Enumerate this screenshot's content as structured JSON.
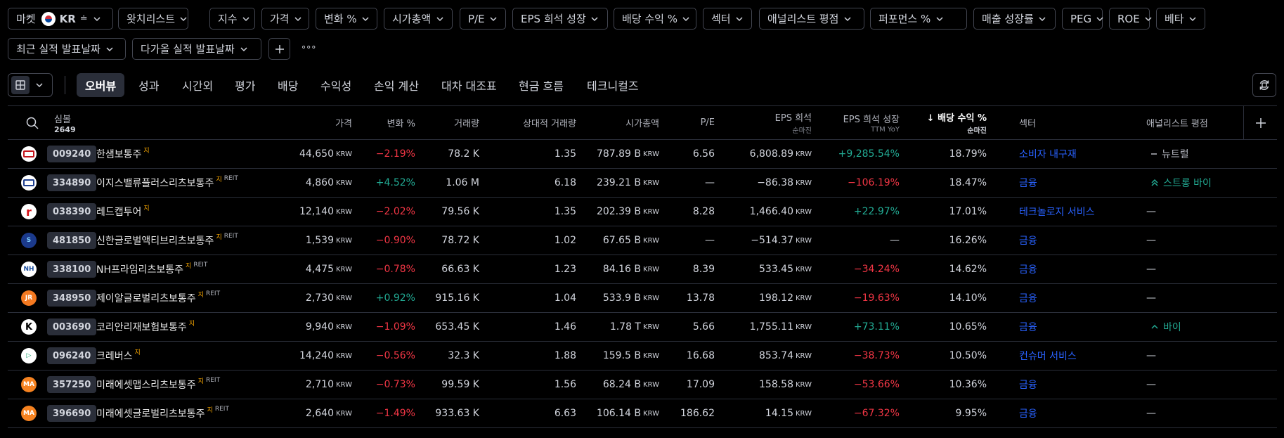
{
  "filters_row1": [
    {
      "label": "마켓",
      "region": "KR",
      "extra": "≐"
    },
    {
      "label": "왓치리스트"
    },
    {
      "label": "지수"
    },
    {
      "label": "가격"
    },
    {
      "label": "변화 %"
    },
    {
      "label": "시가총액"
    },
    {
      "label": "P/E"
    },
    {
      "label": "EPS 희석 성장"
    },
    {
      "label": "배당 수익 %"
    },
    {
      "label": "섹터"
    },
    {
      "label": "애널리스트 평점"
    },
    {
      "label": "퍼포먼스 %"
    },
    {
      "label": "매출 성장률"
    },
    {
      "label": "PEG"
    },
    {
      "label": "ROE"
    },
    {
      "label": "베타"
    }
  ],
  "filters_row2": [
    {
      "label": "최근 실적 발표날짜"
    },
    {
      "label": "다가올 실적 발표날짜"
    }
  ],
  "more_label": "∘∘∘",
  "tabs": [
    "오버뷰",
    "성과",
    "시간외",
    "평가",
    "배당",
    "수익성",
    "손익 계산",
    "대차 대조표",
    "현금 흐름",
    "테크니컬즈"
  ],
  "columns": {
    "symbol": "심볼",
    "count": "2649",
    "price": "가격",
    "change": "변화 %",
    "volume": "거래량",
    "relvol": "상대적 거래량",
    "mcap": "시가총액",
    "pe": "P/E",
    "eps": "EPS 희석",
    "eps_sub": "순마진",
    "epsg": "EPS 희석 성장",
    "epsg_sub": "TTM YoY",
    "div": "↓ 배당 수익 %",
    "div_sub": "순마진",
    "sector": "섹터",
    "analyst": "애널리스트 평점"
  },
  "unit_krw": "KRW",
  "rows": [
    {
      "code": "009240",
      "name": "한샘보통주",
      "di": "지",
      "reit": "",
      "logo_text": "HANSSEM",
      "logo_bg": "#ffffff",
      "logo_fg": "#c4161c",
      "price": "44,650",
      "change": "−2.19%",
      "change_dir": "neg",
      "volume": "78.2 K",
      "relvol": "1.35",
      "mcap": "787.89 B",
      "pe": "6.56",
      "eps": "6,808.89",
      "epsg": "+9,285.54%",
      "epsg_dir": "pos",
      "div": "18.79%",
      "sector": "소비자 내구재",
      "analyst": "뉴트럴",
      "analyst_kind": "neutral"
    },
    {
      "code": "334890",
      "name": "이지스밸류플러스리츠보통주",
      "di": "지",
      "reit": "REIT",
      "logo_text": "IGIS",
      "logo_bg": "#ffffff",
      "logo_fg": "#1f3f8f",
      "price": "4,860",
      "change": "+4.52%",
      "change_dir": "pos",
      "volume": "1.06 M",
      "relvol": "6.18",
      "mcap": "239.21 B",
      "pe": "—",
      "eps": "−86.38",
      "epsg": "−106.19%",
      "epsg_dir": "neg",
      "div": "18.47%",
      "sector": "금융",
      "analyst": "스트롱 바이",
      "analyst_kind": "strongbuy"
    },
    {
      "code": "038390",
      "name": "레드캡투어",
      "di": "지",
      "reit": "",
      "logo_text": "r",
      "logo_bg": "#ffffff",
      "logo_fg": "#d7141a",
      "price": "12,140",
      "change": "−2.02%",
      "change_dir": "neg",
      "volume": "79.56 K",
      "relvol": "1.35",
      "mcap": "202.39 B",
      "pe": "8.28",
      "eps": "1,466.40",
      "epsg": "+22.97%",
      "epsg_dir": "pos",
      "div": "17.01%",
      "sector": "테크놀로지 서비스",
      "analyst": "—",
      "analyst_kind": "none"
    },
    {
      "code": "481850",
      "name": "신한글로벌액티브리츠보통주",
      "di": "지",
      "reit": "REIT",
      "logo_text": "S",
      "logo_bg": "#1b3a8c",
      "logo_fg": "#7fd1ff",
      "price": "1,539",
      "change": "−0.90%",
      "change_dir": "neg",
      "volume": "78.72 K",
      "relvol": "1.02",
      "mcap": "67.65 B",
      "pe": "—",
      "eps": "−514.37",
      "epsg": "—",
      "epsg_dir": "none",
      "div": "16.26%",
      "sector": "금융",
      "analyst": "—",
      "analyst_kind": "none"
    },
    {
      "code": "338100",
      "name": "NH프라임리츠보통주",
      "di": "지",
      "reit": "REIT",
      "logo_text": "NH",
      "logo_bg": "#ffffff",
      "logo_fg": "#1c4fa0",
      "price": "4,475",
      "change": "−0.78%",
      "change_dir": "neg",
      "volume": "66.63 K",
      "relvol": "1.23",
      "mcap": "84.16 B",
      "pe": "8.39",
      "eps": "533.45",
      "epsg": "−34.24%",
      "epsg_dir": "neg",
      "div": "14.62%",
      "sector": "금융",
      "analyst": "—",
      "analyst_kind": "none"
    },
    {
      "code": "348950",
      "name": "제이알글로벌리츠보통주",
      "di": "지",
      "reit": "REIT",
      "logo_text": "JR",
      "logo_bg": "#f47920",
      "logo_fg": "#ffffff",
      "price": "2,730",
      "change": "+0.92%",
      "change_dir": "pos",
      "volume": "915.16 K",
      "relvol": "1.04",
      "mcap": "533.9 B",
      "pe": "13.78",
      "eps": "198.12",
      "epsg": "−19.63%",
      "epsg_dir": "neg",
      "div": "14.10%",
      "sector": "금융",
      "analyst": "—",
      "analyst_kind": "none"
    },
    {
      "code": "003690",
      "name": "코리안리재보험보통주",
      "di": "지",
      "reit": "",
      "logo_text": "K",
      "logo_bg": "#ffffff",
      "logo_fg": "#000000",
      "price": "9,940",
      "change": "−1.09%",
      "change_dir": "neg",
      "volume": "653.45 K",
      "relvol": "1.46",
      "mcap": "1.78 T",
      "pe": "5.66",
      "eps": "1,755.11",
      "epsg": "+73.11%",
      "epsg_dir": "pos",
      "div": "10.65%",
      "sector": "금융",
      "analyst": "바이",
      "analyst_kind": "buy"
    },
    {
      "code": "096240",
      "name": "크레버스",
      "di": "지",
      "reit": "",
      "logo_text": "▷",
      "logo_bg": "#ffffff",
      "logo_fg": "#1aa36b",
      "price": "14,240",
      "change": "−0.56%",
      "change_dir": "neg",
      "volume": "32.3 K",
      "relvol": "1.88",
      "mcap": "159.5 B",
      "pe": "16.68",
      "eps": "853.74",
      "epsg": "−38.73%",
      "epsg_dir": "neg",
      "div": "10.50%",
      "sector": "컨슈머 서비스",
      "analyst": "—",
      "analyst_kind": "none"
    },
    {
      "code": "357250",
      "name": "미래에셋맵스리츠보통주",
      "di": "지",
      "reit": "REIT",
      "logo_text": "MA",
      "logo_bg": "#f58220",
      "logo_fg": "#ffffff",
      "price": "2,710",
      "change": "−0.73%",
      "change_dir": "neg",
      "volume": "99.59 K",
      "relvol": "1.56",
      "mcap": "68.24 B",
      "pe": "17.09",
      "eps": "158.58",
      "epsg": "−53.66%",
      "epsg_dir": "neg",
      "div": "10.36%",
      "sector": "금융",
      "analyst": "—",
      "analyst_kind": "none"
    },
    {
      "code": "396690",
      "name": "미래에셋글로벌리츠보통주",
      "di": "지",
      "reit": "REIT",
      "logo_text": "MA",
      "logo_bg": "#f58220",
      "logo_fg": "#ffffff",
      "price": "2,640",
      "change": "−1.49%",
      "change_dir": "neg",
      "volume": "933.63 K",
      "relvol": "6.63",
      "mcap": "106.14 B",
      "pe": "186.62",
      "eps": "14.15",
      "epsg": "−67.32%",
      "epsg_dir": "neg",
      "div": "9.95%",
      "sector": "금융",
      "analyst": "—",
      "analyst_kind": "none"
    }
  ],
  "colors": {
    "negative": "#f23645",
    "positive": "#22ab94",
    "link": "#2962ff",
    "border": "#434651",
    "active_tab": "#2a2e39"
  }
}
